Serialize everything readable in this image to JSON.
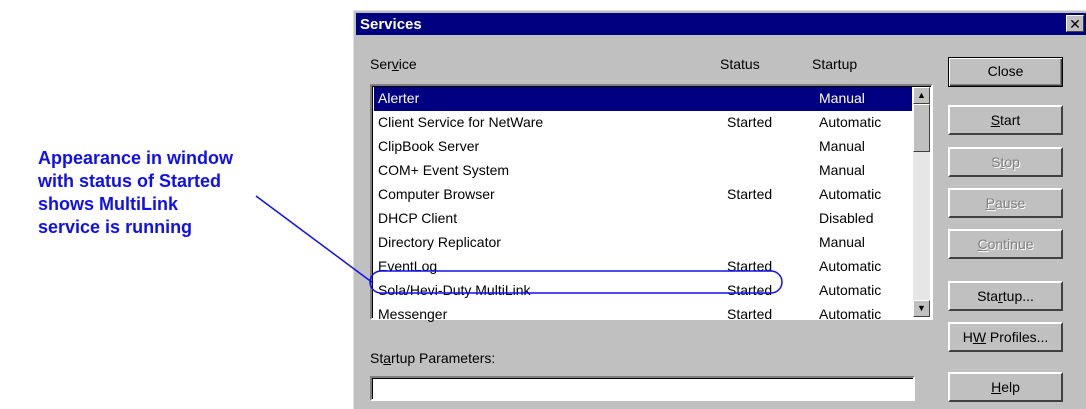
{
  "callout": {
    "lines": [
      "Appearance in window",
      "with status of Started",
      "shows MultiLink",
      "service is running"
    ]
  },
  "window": {
    "title": "Services",
    "close_glyph": "✕"
  },
  "headers": {
    "service": "Service",
    "status": "Status",
    "startup": "Startup"
  },
  "services": [
    {
      "name": "Alerter",
      "status": "",
      "startup": "Manual",
      "selected": true
    },
    {
      "name": "Client Service for NetWare",
      "status": "Started",
      "startup": "Automatic"
    },
    {
      "name": "ClipBook Server",
      "status": "",
      "startup": "Manual"
    },
    {
      "name": "COM+ Event System",
      "status": "",
      "startup": "Manual"
    },
    {
      "name": "Computer Browser",
      "status": "Started",
      "startup": "Automatic"
    },
    {
      "name": "DHCP Client",
      "status": "",
      "startup": "Disabled"
    },
    {
      "name": "Directory Replicator",
      "status": "",
      "startup": "Manual"
    },
    {
      "name": "EventLog",
      "status": "Started",
      "startup": "Automatic"
    },
    {
      "name": "Sola/Hevi-Duty MultiLink",
      "status": "Started",
      "startup": "Automatic",
      "highlighted": true
    },
    {
      "name": "Messenger",
      "status": "Started",
      "startup": "Automatic"
    }
  ],
  "buttons": {
    "close": "Close",
    "start": "Start",
    "stop": "Stop",
    "pause": "Pause",
    "continue": "Continue",
    "startup": "Startup...",
    "hw_profiles": "HW Profiles...",
    "help": "Help"
  },
  "startup_parameters": {
    "label": "Startup Parameters:",
    "value": ""
  },
  "icons": {
    "scroll_up": "scroll-up-arrow-icon",
    "scroll_down": "scroll-down-arrow-icon"
  },
  "colors": {
    "callout": "#1010ee",
    "titlebar": "#000080",
    "selection": "#000080",
    "dialog_bg": "#c0c0c0"
  }
}
